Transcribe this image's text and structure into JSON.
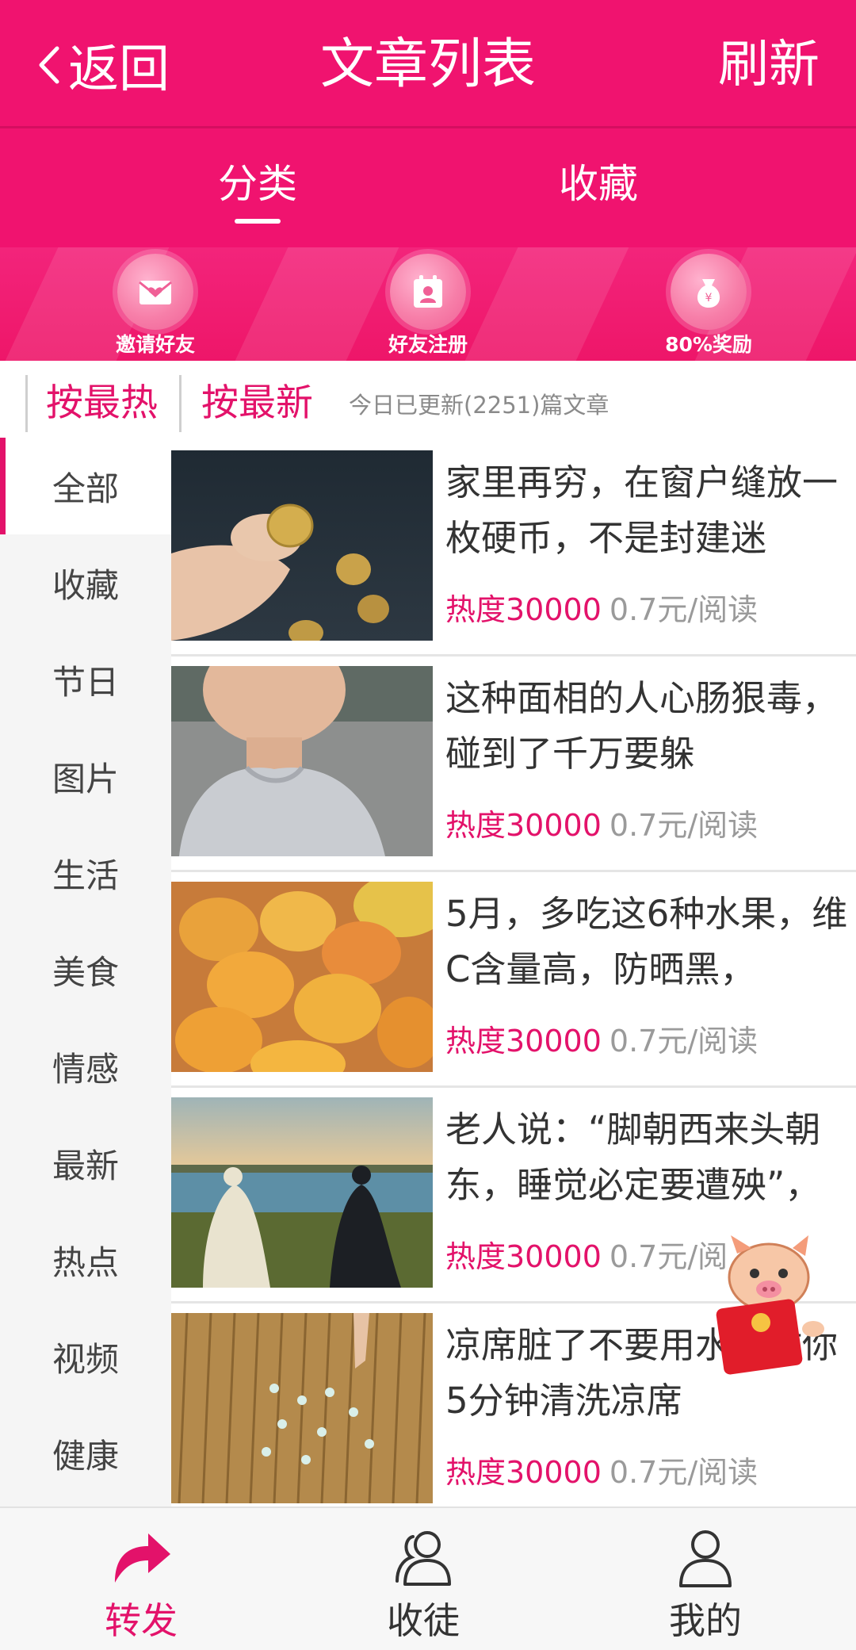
{
  "header": {
    "back_label": "返回",
    "title": "文章列表",
    "refresh_label": "刷新"
  },
  "tabs": [
    {
      "label": "分类",
      "active": true
    },
    {
      "label": "收藏",
      "active": false
    }
  ],
  "promo": [
    {
      "label": "邀请好友",
      "icon": "invite-envelope-icon"
    },
    {
      "label": "好友注册",
      "icon": "register-calendar-icon"
    },
    {
      "label": "80%奖励",
      "icon": "money-bag-icon"
    }
  ],
  "sort": {
    "hot_label": "按最热",
    "new_label": "按最新",
    "info": "今日已更新(2251)篇文章"
  },
  "categories": [
    "全部",
    "收藏",
    "节日",
    "图片",
    "生活",
    "美食",
    "情感",
    "最新",
    "热点",
    "视频",
    "健康"
  ],
  "active_category": "全部",
  "articles": [
    {
      "title": "家里再穷，在窗户缝放一枚硬币，不是封建迷",
      "heat": "热度30000",
      "price": "0.7元/阅读",
      "image": "coins-photo"
    },
    {
      "title": "这种面相的人心肠狠毒，碰到了千万要躲",
      "heat": "热度30000",
      "price": "0.7元/阅读",
      "image": "man-portrait-photo"
    },
    {
      "title": "5月，多吃这6种水果，维C含量高，防晒黑，",
      "heat": "热度30000",
      "price": "0.7元/阅读",
      "image": "mangoes-photo"
    },
    {
      "title": "老人说：“脚朝西来头朝东，睡觉必定要遭殃”，",
      "heat": "热度30000",
      "price": "0.7元/阅",
      "image": "lakeside-couple-photo"
    },
    {
      "title": "凉席脏了不要用水，教你5分钟清洗凉席",
      "heat": "热度30000",
      "price": "0.7元/阅读",
      "image": "bamboo-mat-photo"
    }
  ],
  "bottom_nav": [
    {
      "label": "转发",
      "icon": "share-arrow-icon",
      "active": true
    },
    {
      "label": "收徒",
      "icon": "users-icon",
      "active": false
    },
    {
      "label": "我的",
      "icon": "user-icon",
      "active": false
    }
  ],
  "colors": {
    "accent": "#f0136f",
    "text": "#333333",
    "muted": "#9a9a9a"
  }
}
